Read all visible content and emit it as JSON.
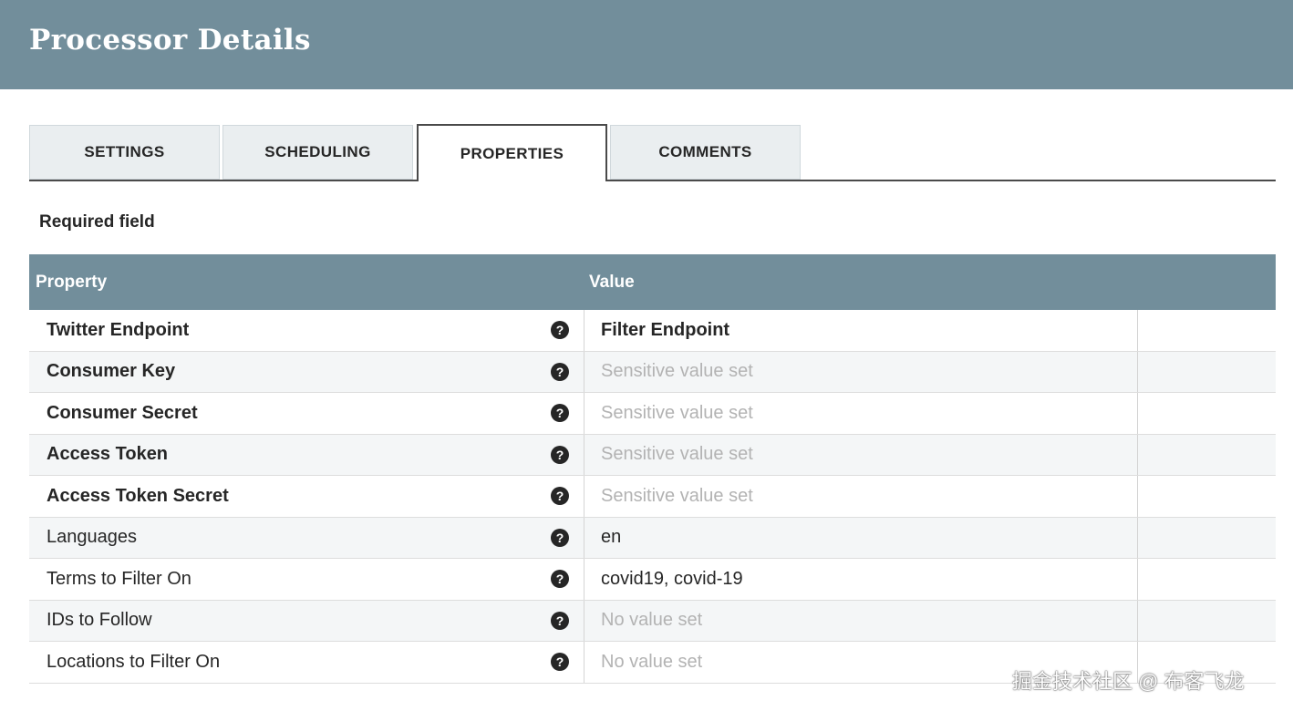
{
  "header": {
    "title": "Processor Details"
  },
  "tabs": [
    {
      "label": "SETTINGS",
      "active": false
    },
    {
      "label": "SCHEDULING",
      "active": false
    },
    {
      "label": "PROPERTIES",
      "active": true
    },
    {
      "label": "COMMENTS",
      "active": false
    }
  ],
  "required_label": "Required field",
  "table": {
    "columns": {
      "property": "Property",
      "value": "Value"
    },
    "rows": [
      {
        "name": "Twitter Endpoint",
        "required": true,
        "value": "Filter Endpoint",
        "value_style": "bold"
      },
      {
        "name": "Consumer Key",
        "required": true,
        "value": "Sensitive value set",
        "value_style": "muted"
      },
      {
        "name": "Consumer Secret",
        "required": true,
        "value": "Sensitive value set",
        "value_style": "muted"
      },
      {
        "name": "Access Token",
        "required": true,
        "value": "Sensitive value set",
        "value_style": "muted"
      },
      {
        "name": "Access Token Secret",
        "required": true,
        "value": "Sensitive value set",
        "value_style": "muted"
      },
      {
        "name": "Languages",
        "required": false,
        "value": "en",
        "value_style": "normal"
      },
      {
        "name": "Terms to Filter On",
        "required": false,
        "value": "covid19, covid-19",
        "value_style": "normal"
      },
      {
        "name": "IDs to Follow",
        "required": false,
        "value": "No value set",
        "value_style": "muted"
      },
      {
        "name": "Locations to Filter On",
        "required": false,
        "value": "No value set",
        "value_style": "muted"
      }
    ]
  },
  "help_icon_glyph": "?",
  "watermark": "掘金技术社区 @ 布客飞龙",
  "colors": {
    "header_bg": "#728e9b",
    "muted_text": "#b3b3b3"
  }
}
